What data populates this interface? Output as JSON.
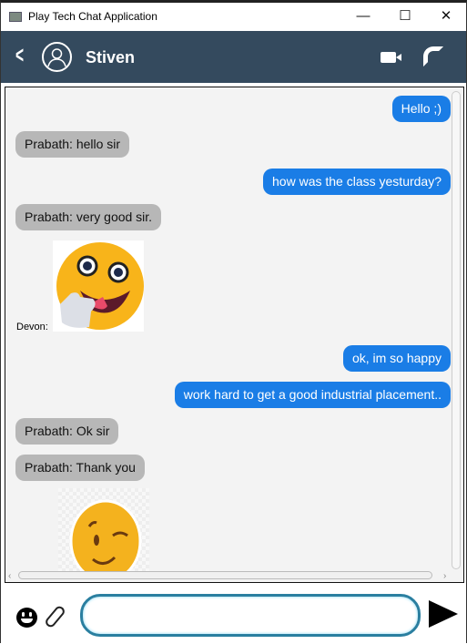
{
  "window": {
    "title": "Play Tech Chat Application",
    "minimize": "—",
    "maximize": "☐",
    "close": "✕"
  },
  "header": {
    "contact_name": "Stiven",
    "back": "<"
  },
  "messages": [
    {
      "side": "out",
      "text": "Hello ;)"
    },
    {
      "side": "in",
      "text": "Prabath:  hello sir"
    },
    {
      "side": "out",
      "text": "how was the class yesturday?"
    },
    {
      "side": "in",
      "text": "Prabath:  very good sir."
    },
    {
      "side": "in",
      "sender": "Devon:",
      "type": "image",
      "image": "thumbs-up-emoji"
    },
    {
      "side": "out",
      "text": "ok, im so happy"
    },
    {
      "side": "out",
      "text": "work hard to get a good industrial placement.."
    },
    {
      "side": "in",
      "text": "Prabath:  Ok sir"
    },
    {
      "side": "in",
      "text": "Prabath:  Thank you"
    },
    {
      "side": "in",
      "type": "image",
      "image": "wink-emoji"
    }
  ],
  "composer": {
    "value": "",
    "placeholder": ""
  },
  "colors": {
    "header": "#344a5e",
    "outgoing": "#1a7de6",
    "incoming": "#b7b7b7"
  }
}
